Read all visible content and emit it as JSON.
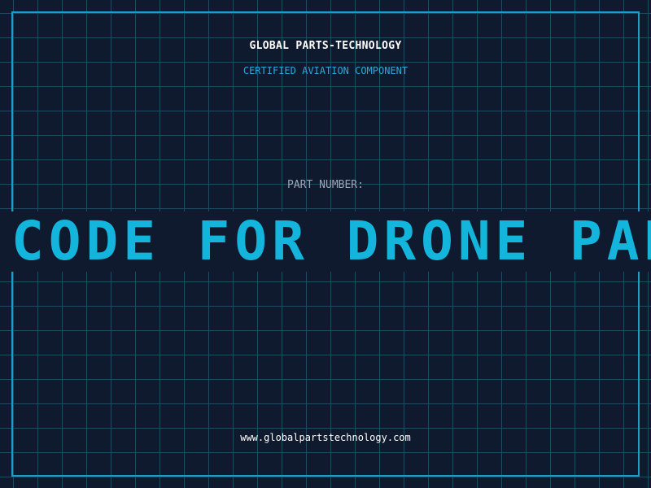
{
  "header": {
    "brand": "GLOBAL PARTS-TECHNOLOGY",
    "subtitle": "CERTIFIED AVIATION COMPONENT"
  },
  "part": {
    "label": "PART NUMBER:",
    "code": "CODE FOR DRONE PARTS"
  },
  "footer": {
    "url": "www.globalpartstechnology.com"
  },
  "colors": {
    "background": "#101a2e",
    "grid": "#1e4a63",
    "accent": "#13b5dd",
    "frame": "#1aa0c8"
  }
}
